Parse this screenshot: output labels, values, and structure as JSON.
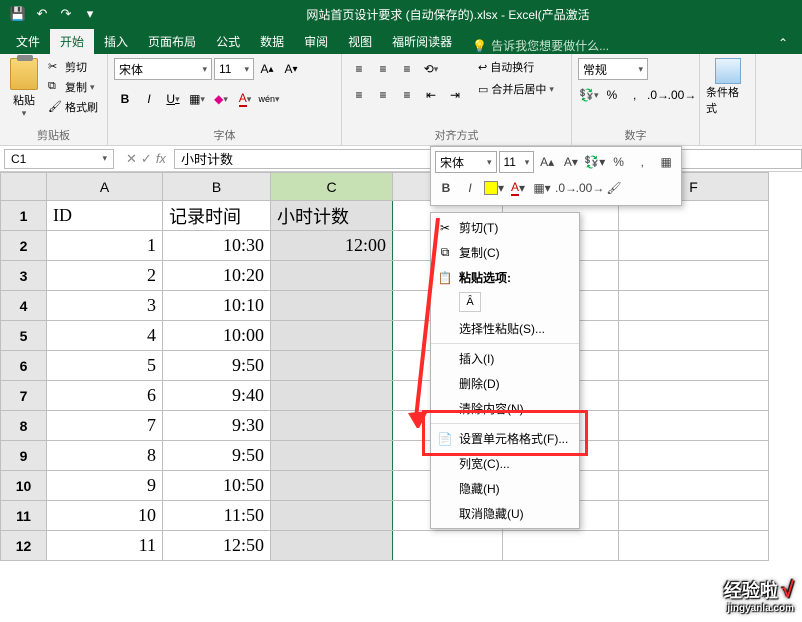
{
  "titlebar": {
    "title": "网站首页设计要求 (自动保存的).xlsx - Excel(产品激活"
  },
  "tabs": {
    "file": "文件",
    "home": "开始",
    "insert": "插入",
    "layout": "页面布局",
    "formulas": "公式",
    "data": "数据",
    "review": "审阅",
    "view": "视图",
    "foxit": "福昕阅读器",
    "tellme": "告诉我您想要做什么..."
  },
  "clipboard": {
    "paste": "粘贴",
    "cut": "剪切",
    "copy": "复制",
    "painter": "格式刷",
    "label": "剪贴板"
  },
  "font": {
    "name": "宋体",
    "size": "11",
    "label": "字体",
    "wen": "wén"
  },
  "align": {
    "wrap": "自动换行",
    "merge": "合并后居中",
    "label": "对齐方式"
  },
  "number": {
    "format": "常规",
    "label": "数字"
  },
  "cond": {
    "label": "条件格式"
  },
  "namebox": "C1",
  "formula": "小时计数",
  "cols": [
    "A",
    "B",
    "C",
    "D",
    "E",
    "F"
  ],
  "table": {
    "headers": {
      "A": "ID",
      "B": "记录时间",
      "C": "小时计数"
    },
    "rows": [
      {
        "r": "1"
      },
      {
        "r": "2",
        "A": "1",
        "B": "10:30",
        "C": "12:00"
      },
      {
        "r": "3",
        "A": "2",
        "B": "10:20"
      },
      {
        "r": "4",
        "A": "3",
        "B": "10:10"
      },
      {
        "r": "5",
        "A": "4",
        "B": "10:00"
      },
      {
        "r": "6",
        "A": "5",
        "B": "9:50"
      },
      {
        "r": "7",
        "A": "6",
        "B": "9:40"
      },
      {
        "r": "8",
        "A": "7",
        "B": "9:30"
      },
      {
        "r": "9",
        "A": "8",
        "B": "9:50"
      },
      {
        "r": "10",
        "A": "9",
        "B": "10:50"
      },
      {
        "r": "11",
        "A": "10",
        "B": "11:50"
      },
      {
        "r": "12",
        "A": "11",
        "B": "12:50"
      }
    ]
  },
  "minitb": {
    "font": "宋体",
    "size": "11"
  },
  "ctx": {
    "cut": "剪切(T)",
    "copy": "复制(C)",
    "paste_label": "粘贴选项:",
    "paste_special": "选择性粘贴(S)...",
    "insert": "插入(I)",
    "delete": "删除(D)",
    "clear": "清除内容(N)",
    "format_cells": "设置单元格格式(F)...",
    "colwidth": "列宽(C)...",
    "hide": "隐藏(H)",
    "unhide": "取消隐藏(U)"
  },
  "watermark": {
    "main": "经验啦",
    "check": "√",
    "sub": "jingyanla.com"
  }
}
